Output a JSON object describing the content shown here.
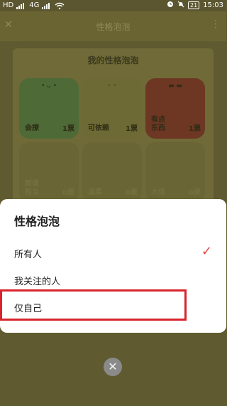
{
  "status_bar": {
    "left_badges": [
      "HD",
      "HD"
    ],
    "signal_label": "4G",
    "battery": "21",
    "time": "15:03"
  },
  "topbar": {
    "title": "性格泡泡",
    "back_icon": "close-icon",
    "more_icon": "more-icon"
  },
  "panel": {
    "title": "我的性格泡泡",
    "bubbles": [
      {
        "name": "会撩",
        "count": "1票"
      },
      {
        "name": "可依赖",
        "count": "1票"
      },
      {
        "name": "有点\n东西",
        "count": "1票"
      },
      {
        "name": "颜值\n担当",
        "count": "0票"
      },
      {
        "name": "温柔",
        "count": "0票"
      },
      {
        "name": "大佬",
        "count": "0票"
      }
    ]
  },
  "sheet": {
    "title": "性格泡泡",
    "options": [
      {
        "label": "所有人",
        "selected": true
      },
      {
        "label": "我关注的人",
        "selected": false
      },
      {
        "label": "仅自己",
        "selected": false
      }
    ]
  },
  "colors": {
    "accent_check": "#e0453f",
    "highlight_box": "#d8242c"
  }
}
